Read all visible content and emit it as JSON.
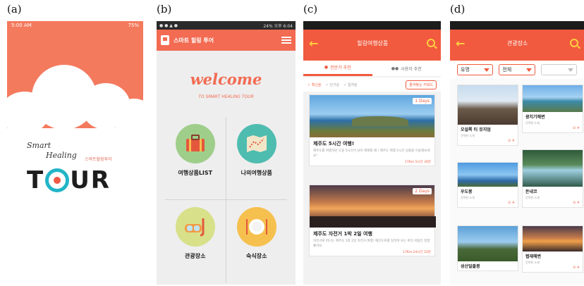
{
  "labels": {
    "a": "(a)",
    "b": "(b)",
    "c": "(c)",
    "d": "(d)"
  },
  "screenA": {
    "status_time": "5:00 AM",
    "status_battery": "75%",
    "logo_script_1": "Smart",
    "logo_script_2": "Healing",
    "logo_korean": "스마트힐링투어",
    "logo_t": "T",
    "logo_rest": "UR"
  },
  "screenB": {
    "status_right": "24% 오후 6:04",
    "app_title": "스마트 힐링 투어",
    "welcome": "welcome",
    "subtitle": "TO SMART HEALING TOUR",
    "menu": [
      {
        "label": "여행상품LIST",
        "icon": "suitcase-icon",
        "color": "#9fce8a"
      },
      {
        "label": "나의여행상품",
        "icon": "map-icon",
        "color": "#4fbcb0"
      },
      {
        "label": "관광장소",
        "icon": "snorkel-icon",
        "color": "#d8e08a"
      },
      {
        "label": "숙식장소",
        "icon": "plate-icon",
        "color": "#f6c04e"
      }
    ]
  },
  "screenC": {
    "title": "힐링여행상품",
    "tabs": [
      "전문가 추천",
      "사용자 추천"
    ],
    "filters": [
      "최신순",
      "인기순",
      "일자순"
    ],
    "keyword_button": "즐겨찾는 키워드",
    "cards": [
      {
        "days": "1 Days",
        "title": "제주도 5시간 여행!",
        "desc": "제주도를 여행하던 도중 5시간이 남아 애매할 때 ! 제주도 여행 5시간 상품을 이용해보세요!",
        "meta": "17Km 5시간 30분"
      },
      {
        "days": "2 Days",
        "title": "제주도 자전거 1박 2일 여행",
        "desc": "자전거로 떠나는 제주도 1박 2일 자전거 여행! 해안도로를 달리며 보는 바다 바람은 정말 좋아요",
        "meta": "17Km 24시간 10분"
      }
    ]
  },
  "screenD": {
    "title": "관광장소",
    "dropdowns": [
      "유명",
      "전체",
      ""
    ],
    "places": [
      {
        "name": "오설록 티 뮤지엄",
        "desc": "간략한 소개"
      },
      {
        "name": "광치기해변",
        "desc": "간략한 소개"
      },
      {
        "name": "우도봉",
        "desc": "간략한 소개"
      },
      {
        "name": "돈내코",
        "desc": "간략한 소개"
      },
      {
        "name": "성산일출봉",
        "desc": ""
      },
      {
        "name": "협재해변",
        "desc": "간략한 소개"
      }
    ]
  }
}
